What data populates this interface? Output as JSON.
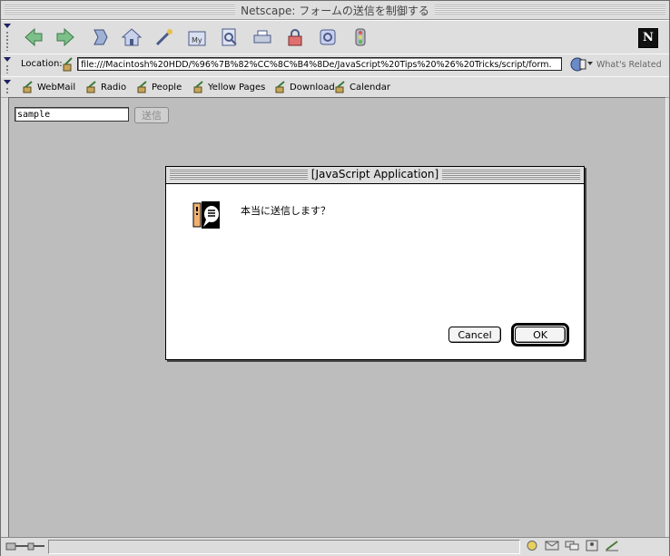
{
  "window": {
    "title": "Netscape: フォームの送信を制御する"
  },
  "toolbar": {
    "buttons": [
      {
        "name": "back-icon",
        "color": "#5aa06a"
      },
      {
        "name": "forward-icon",
        "color": "#5aa06a"
      },
      {
        "name": "reload-icon",
        "color": "#5577aa"
      },
      {
        "name": "home-icon",
        "color": "#7788bb"
      },
      {
        "name": "search-icon",
        "color": "#c8a040"
      },
      {
        "name": "my-netscape-icon",
        "color": "#7788aa"
      },
      {
        "name": "images-icon",
        "color": "#6688aa"
      },
      {
        "name": "print-icon",
        "color": "#8899aa"
      },
      {
        "name": "security-icon",
        "color": "#cc5555"
      },
      {
        "name": "shop-icon",
        "color": "#7788cc"
      },
      {
        "name": "stop-icon",
        "color": "#9999aa"
      }
    ],
    "logo_label": "N"
  },
  "location": {
    "label": "Location:",
    "url": "file:///Macintosh%20HDD/%96%7B%82%CC%8C%B4%8De/JavaScript%20Tips%20%26%20Tricks/script/form.",
    "related_label": "What's Related"
  },
  "bookmarks": [
    {
      "label": "WebMail"
    },
    {
      "label": "Radio"
    },
    {
      "label": "People"
    },
    {
      "label": "Yellow Pages"
    },
    {
      "label": "Download"
    },
    {
      "label": "Calendar"
    }
  ],
  "form": {
    "text_value": "sample",
    "submit_label": "送信"
  },
  "dialog": {
    "title": "[JavaScript Application]",
    "message": "本当に送信します？",
    "cancel_label": "Cancel",
    "ok_label": "OK"
  },
  "colors": {
    "chrome": "#dedede",
    "content_bg": "#bdbdbd",
    "dialog_bg": "#ffffff"
  }
}
